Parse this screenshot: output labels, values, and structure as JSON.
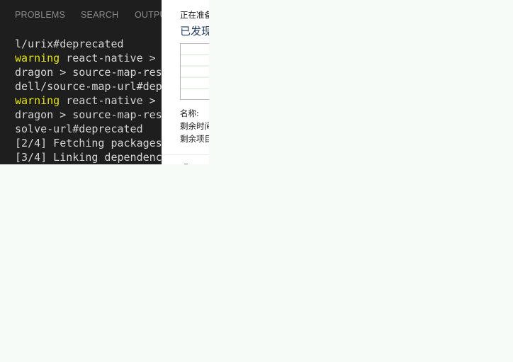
{
  "panel": {
    "tabs": [
      {
        "label": "PROBLEMS"
      },
      {
        "label": "SEARCH"
      },
      {
        "label": "OUTPUT"
      }
    ]
  },
  "terminal": {
    "lines": [
      {
        "prefix": "",
        "text": "l/urix#deprecated"
      },
      {
        "prefix": "warning",
        "text": " react-native >"
      },
      {
        "prefix": "",
        "text": "dragon > source-map-res"
      },
      {
        "prefix": "",
        "text": "dell/source-map-url#dep"
      },
      {
        "prefix": "warning",
        "text": " react-native >"
      },
      {
        "prefix": "",
        "text": "dragon > source-map-res"
      },
      {
        "prefix": "",
        "text": "solve-url#deprecated"
      },
      {
        "prefix": "",
        "text": "[2/4] Fetching packages"
      },
      {
        "prefix": "",
        "text": "[3/4] Linking dependenc"
      }
    ],
    "colors": {
      "background": "#1e1e1e",
      "text": "#d4d4d4",
      "warning": "#e5e510"
    }
  },
  "dialog": {
    "caption": "正在准备",
    "heading": "已发现",
    "details": {
      "name_label": "名称:",
      "time_left_label": "剩余时间",
      "items_left_label": "剩余项目"
    },
    "colors": {
      "heading": "#1e395b",
      "graph_grid": "#cfe7cf"
    }
  }
}
